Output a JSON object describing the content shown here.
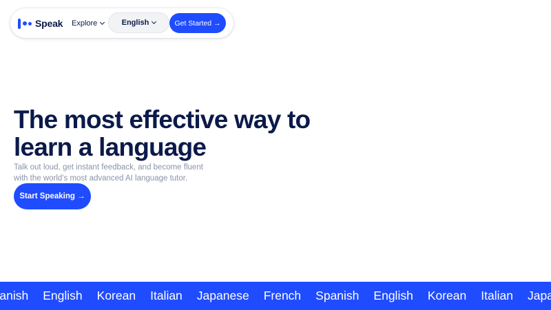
{
  "nav": {
    "logo_text": "Speak",
    "explore_label": "Explore",
    "language_selected": "English",
    "cta_label": "Get Started →"
  },
  "hero": {
    "title_line1": "The most effective way to",
    "title_line2": "learn a language",
    "subtitle_line1": "Talk out loud, get instant feedback, and become fluent",
    "subtitle_line2": "with the world's most advanced AI language tutor.",
    "cta_label": "Start Speaking →"
  },
  "languages": [
    "Spanish",
    "English",
    "Korean",
    "Italian",
    "Japanese",
    "French",
    "Spanish",
    "English",
    "Korean",
    "Italian",
    "Japanese"
  ],
  "colors": {
    "brand_blue": "#1f4cff",
    "heading_navy": "#0b1a4a",
    "muted_text": "#8a93a8",
    "select_bg": "#f2f3f5"
  },
  "icons": [
    "speak-logo-icon",
    "chevron-down-icon",
    "arrow-right-icon"
  ]
}
